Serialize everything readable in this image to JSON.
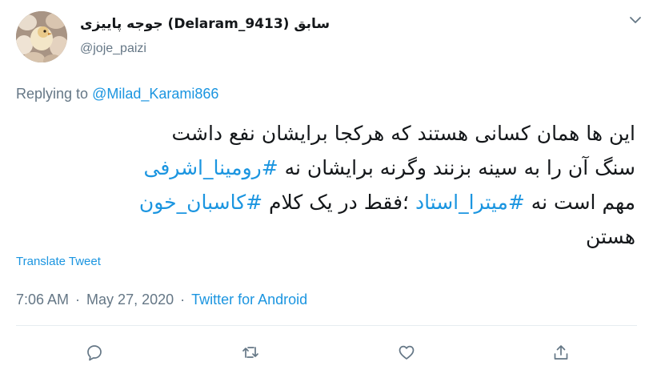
{
  "author": {
    "display_name": "جوجه پاییزی (Delaram_9413) سابق",
    "handle": "@joje_paizi"
  },
  "reply": {
    "prefix": "Replying to",
    "to": "@Milad_Karami866"
  },
  "tweet": {
    "line1": "این ها همان کسانی هستند که هرکجا برایشان نفع داشت",
    "line2_text": "سنگ آن را به سینه بزنند وگرنه برایشان نه ",
    "line2_hashtag": "#رومینا_اشرفی",
    "line3_text1": "مهم است نه ",
    "line3_hashtag1": "#میترا_استاد",
    "line3_text2": " ؛فقط در یک کلام ",
    "line3_hashtag2": "#کاسبان_خون",
    "line4": "هستن"
  },
  "translate_label": "Translate Tweet",
  "meta": {
    "time": "7:06 AM",
    "separator": "·",
    "date": "May 27, 2020",
    "source": "Twitter for Android"
  },
  "actions": {
    "icons": [
      "reply-icon",
      "retweet-icon",
      "like-icon",
      "share-icon"
    ]
  },
  "colors": {
    "link": "#1b95e0",
    "secondary_text": "#657786",
    "divider": "#e6ecf0"
  }
}
